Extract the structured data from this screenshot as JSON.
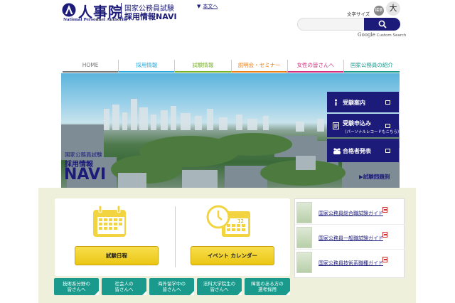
{
  "header": {
    "logo_main": "人事院",
    "logo_en": "National Personnel Authority",
    "logo_sub1": "国家公務員試験",
    "logo_sub2": "採用情報NAVI",
    "skip_link": "本文へ",
    "font_size_label": "文字サイズ",
    "font_std": "標準",
    "font_big": "大",
    "search_placeholder": "",
    "cse_brand": "Google",
    "cse_label": "Custom Search"
  },
  "nav": {
    "items": [
      {
        "label": "HOME",
        "color": "#777777"
      },
      {
        "label": "採用情報",
        "color": "#2aa6d6"
      },
      {
        "label": "試験情報",
        "color": "#7ab02c"
      },
      {
        "label": "説明会・セミナー",
        "color": "#e8801a"
      },
      {
        "label": "女性の皆さんへ",
        "color": "#d2317d"
      },
      {
        "label": "国家公務員の紹介",
        "color": "#1a9a8c"
      }
    ]
  },
  "hero": {
    "title1": "国家公務員試験",
    "title2": "採用情報",
    "title3": "NAVI"
  },
  "side_buttons": [
    {
      "label": "受験案内",
      "sub": "",
      "icon": "info-icon"
    },
    {
      "label": "受験申込み",
      "sub": "（パーソナルレコードもこちら）",
      "icon": "form-icon"
    },
    {
      "label": "合格者発表",
      "sub": "",
      "icon": "crowd-icon"
    }
  ],
  "sample_link": "試験問題例",
  "main_buttons": {
    "schedule": "試験日程",
    "event": "イベント カレンダー"
  },
  "calendar_icon_day": "12",
  "guides": [
    {
      "label": "国家公務員総合職試験ガイド"
    },
    {
      "label": "国家公務員一般職試験ガイド"
    },
    {
      "label": "国家公務員技術系職種ガイド"
    }
  ],
  "teal_buttons": [
    {
      "line1": "技術系分野の",
      "line2": "皆さんへ"
    },
    {
      "line1": "社会人の",
      "line2": "皆さんへ"
    },
    {
      "line1": "海外留学中の",
      "line2": "皆さんへ"
    },
    {
      "line1": "法科大学院生の",
      "line2": "皆さんへ"
    },
    {
      "line1": "障害のある方の",
      "line2": "選考採用"
    }
  ],
  "colors": {
    "brand": "#1c1b7a",
    "teal": "#1a9a8c",
    "yellow": "#f3d330"
  }
}
